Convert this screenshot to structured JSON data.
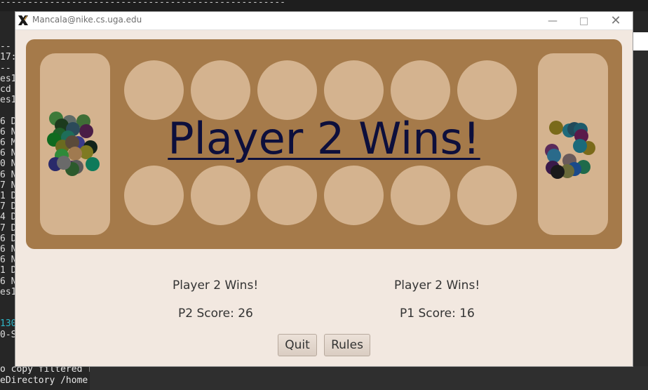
{
  "window": {
    "title": "Mancala@nike.cs.uga.edu",
    "controls": {
      "minimize": "—",
      "close": "✕"
    }
  },
  "board": {
    "message": "Player 2 Wins!"
  },
  "info": {
    "left_status": "Player 2 Wins!",
    "right_status": "Player 2 Wins!",
    "left_score": "P2 Score: 26",
    "right_score": "P1 Score: 16"
  },
  "buttons": {
    "quit": "Quit",
    "rules": "Rules"
  },
  "terminal": {
    "top_dashes": "----------------------------------------------------",
    "bottom_line1": "o copy filtered r",
    "bottom_line2": "eDirectory /home"
  },
  "colors": {
    "board": "#a57a4a",
    "pit": "#d4b38f",
    "window_bg": "#f2e8e0",
    "message": "#0d0f3c"
  }
}
